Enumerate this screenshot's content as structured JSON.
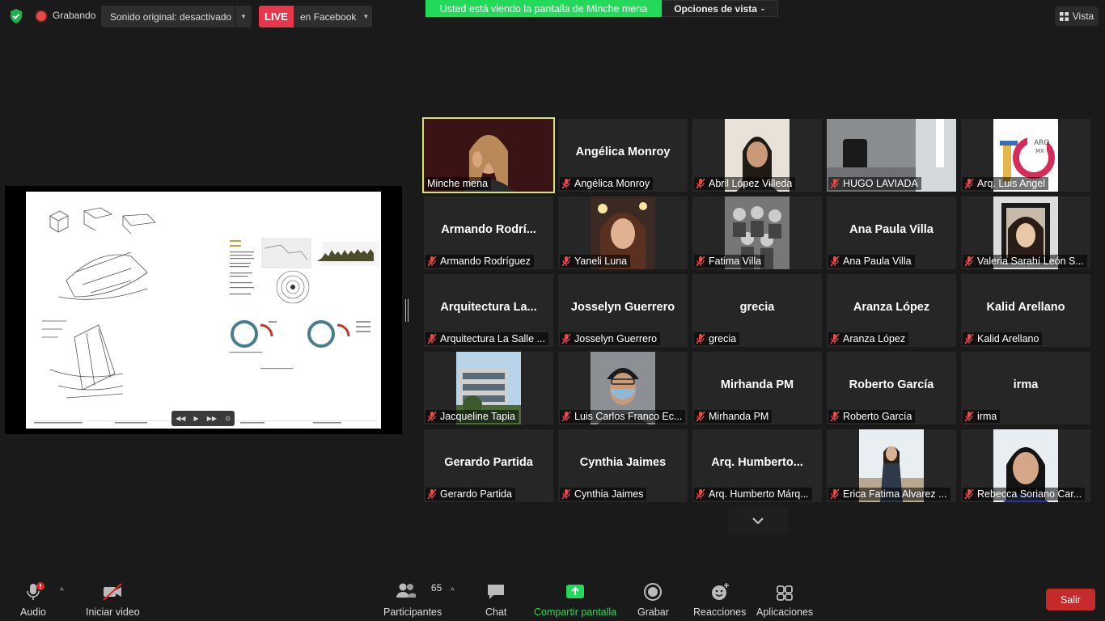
{
  "topbar": {
    "recording": "Grabando",
    "original_sound": "Sonido original: desactivado",
    "live": "LIVE",
    "live_target": "en Facebook",
    "viewing_prefix": "Usted está viendo la pantalla de ",
    "viewing_name": "Minche mena",
    "view_options": "Opciones de vista",
    "view": "Vista"
  },
  "colors": {
    "live": "#e8364b",
    "viewing_banner": "#23d959",
    "active_speaker": "#d9e36a",
    "leave": "#c72a2a",
    "share_green": "#23d959"
  },
  "participants": [
    {
      "display": "",
      "name": "Minche mena",
      "photo": "woman-blonde",
      "muted": false,
      "active": true
    },
    {
      "display": "Angélica Monroy",
      "name": "Angélica Monroy",
      "photo": "",
      "muted": true
    },
    {
      "display": "",
      "name": "Abril López Villeda",
      "photo": "woman-dark-hair",
      "muted": true
    },
    {
      "display": "",
      "name": "HUGO LAVIADA",
      "photo": "room-speaker",
      "muted": true
    },
    {
      "display": "",
      "name": "Arq. Luis Angel",
      "photo": "logo-10-arq",
      "muted": true
    },
    {
      "display": "Armando  Rodrí...",
      "name": "Armando Rodríguez",
      "photo": "",
      "muted": true
    },
    {
      "display": "",
      "name": "Yaneli Luna",
      "photo": "woman-selfie",
      "muted": true
    },
    {
      "display": "",
      "name": "Fatima Villa",
      "photo": "group-bw",
      "muted": true
    },
    {
      "display": "Ana Paula Villa",
      "name": "Ana Paula Villa",
      "photo": "",
      "muted": true
    },
    {
      "display": "",
      "name": "Valeria Sarahí León S...",
      "photo": "woman-frame",
      "muted": true
    },
    {
      "display": "Arquitectura  La...",
      "name": "Arquitectura La Salle ...",
      "photo": "",
      "muted": true
    },
    {
      "display": "Josselyn Guerrero",
      "name": "Josselyn Guerrero",
      "photo": "",
      "muted": true
    },
    {
      "display": "grecia",
      "name": "grecia",
      "photo": "",
      "muted": true
    },
    {
      "display": "Aranza López",
      "name": "Aranza López",
      "photo": "",
      "muted": true
    },
    {
      "display": "Kalid Arellano",
      "name": "Kalid Arellano",
      "photo": "",
      "muted": true
    },
    {
      "display": "",
      "name": "Jacqueline Tapia",
      "photo": "building",
      "muted": true
    },
    {
      "display": "",
      "name": "Luis Carlos Franco Ec...",
      "photo": "man-mask",
      "muted": true
    },
    {
      "display": "Mirhanda PM",
      "name": "Mirhanda PM",
      "photo": "",
      "muted": true
    },
    {
      "display": "Roberto García",
      "name": "Roberto García",
      "photo": "",
      "muted": true
    },
    {
      "display": "irma",
      "name": "irma",
      "photo": "",
      "muted": true
    },
    {
      "display": "Gerardo Partida",
      "name": "Gerardo Partida",
      "photo": "",
      "muted": true
    },
    {
      "display": "Cynthia Jaimes",
      "name": "Cynthia Jaimes",
      "photo": "",
      "muted": true
    },
    {
      "display": "Arq.  Humberto...",
      "name": "Arq. Humberto Márq...",
      "photo": "",
      "muted": true
    },
    {
      "display": "",
      "name": "Erica Fatima Alvarez ...",
      "photo": "woman-outdoor",
      "muted": true
    },
    {
      "display": "",
      "name": "Rebecca Soriano Car...",
      "photo": "woman-smile",
      "muted": true
    }
  ],
  "toolbar": {
    "audio": "Audio",
    "video": "Iniciar video",
    "participants": "Participantes",
    "participants_count": "65",
    "chat": "Chat",
    "share": "Compartir pantalla",
    "record": "Grabar",
    "reactions": "Reacciones",
    "apps": "Aplicaciones",
    "leave": "Salir"
  }
}
